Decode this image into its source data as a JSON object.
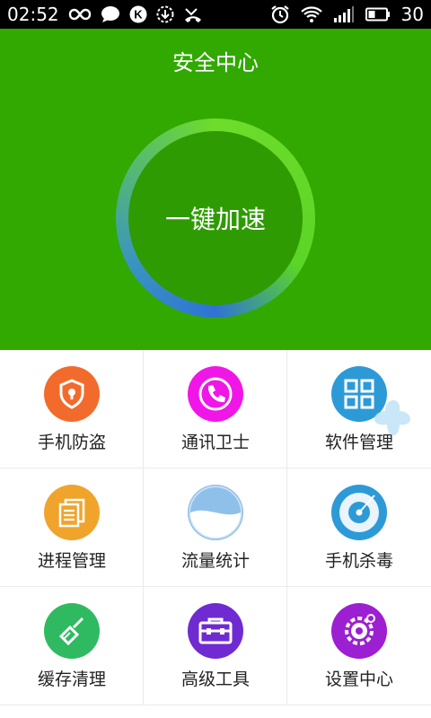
{
  "status_bar": {
    "time": "02:52",
    "icons_left": [
      "infinity-icon",
      "chat-bubble-icon",
      "k-app-icon",
      "download-icon",
      "missed-call-icon"
    ],
    "icons_right": [
      "alarm-icon",
      "wifi-icon",
      "signal-icon",
      "battery-icon"
    ],
    "battery": "30"
  },
  "hero": {
    "title": "安全中心",
    "speed_button": "一键加速"
  },
  "grid": [
    {
      "label": "手机防盗",
      "icon": "shield-lock-icon",
      "color": "#f26b2c"
    },
    {
      "label": "通讯卫士",
      "icon": "phone-icon",
      "color": "#f016e8"
    },
    {
      "label": "软件管理",
      "icon": "app-grid-icon",
      "color": "#2d9ad8"
    },
    {
      "label": "进程管理",
      "icon": "documents-icon",
      "color": "#f0a42c"
    },
    {
      "label": "流量统计",
      "icon": "data-bowl-icon",
      "color": "#8fc0ea"
    },
    {
      "label": "手机杀毒",
      "icon": "radar-icon",
      "color": "#2d9ad8"
    },
    {
      "label": "缓存清理",
      "icon": "brush-icon",
      "color": "#2fba61"
    },
    {
      "label": "高级工具",
      "icon": "toolbox-icon",
      "color": "#6f2bd1"
    },
    {
      "label": "设置中心",
      "icon": "settings-icon",
      "color": "#9c1fd2"
    }
  ]
}
